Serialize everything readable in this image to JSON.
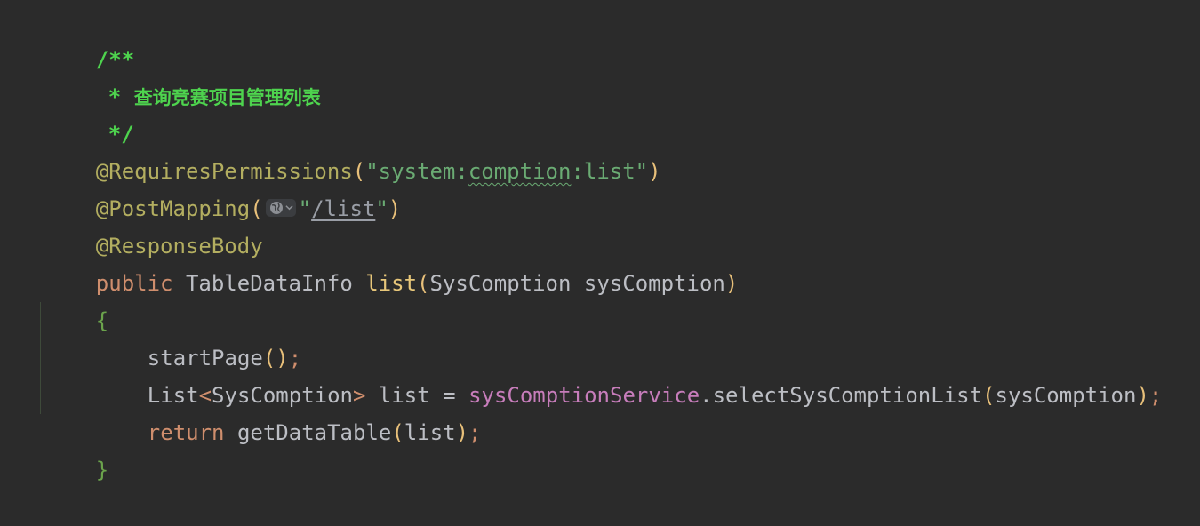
{
  "editor": {
    "language": "java",
    "lines": {
      "doc_open": "/**",
      "doc_star": "* ",
      "doc_text": "查询竞赛项目管理列表",
      "doc_close": "*/",
      "perm_annotation": "@RequiresPermissions",
      "perm_string_prefix": "\"system:",
      "perm_string_typo": "comption",
      "perm_string_suffix": ":list\"",
      "post_annotation": "@PostMapping",
      "post_quote_open": "\"",
      "post_path": "/list",
      "post_quote_close": "\"",
      "response_annotation": "@ResponseBody",
      "kw_public": "public",
      "return_type": "TableDataInfo",
      "method_name": "list",
      "param_type": "SysComption",
      "param_name": "sysComption",
      "open_brace": "{",
      "start_page": "startPage",
      "list_type": "List",
      "generic_type": "SysComption",
      "var_name": "list",
      "assign_op": "=",
      "service_field": "sysComptionService",
      "service_method": "selectSysComptionList",
      "service_arg": "sysComption",
      "kw_return": "return",
      "get_data_table": "getDataTable",
      "return_arg": "list",
      "close_brace": "}"
    },
    "inlay_hint_icons": [
      "globe-icon",
      "chevron-down-icon"
    ]
  },
  "colors": {
    "background": "#2b2b2b",
    "doc_comment": "#4ed44e",
    "annotation": "#b3ae60",
    "keyword": "#cf8e6d",
    "string": "#6aab73",
    "field": "#c77dbb",
    "function": "#e8c77a",
    "text": "#bcbec4"
  }
}
